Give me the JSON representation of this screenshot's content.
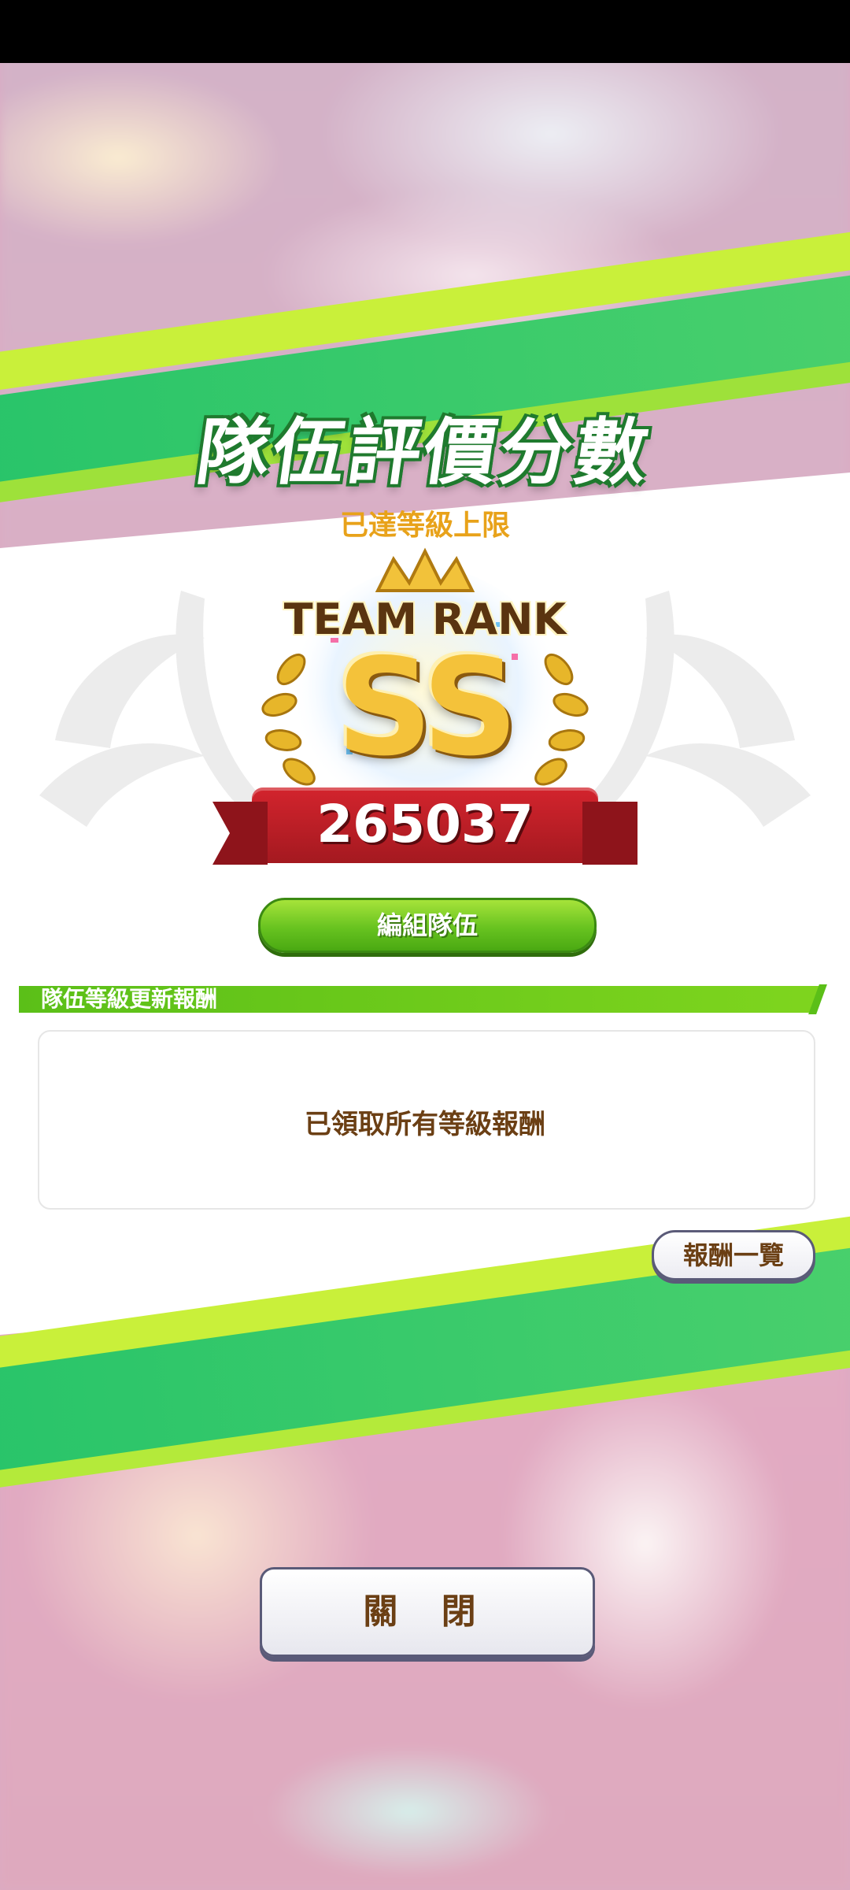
{
  "dialog": {
    "title": "隊伍評價分數",
    "subtitle": "已達等級上限",
    "emblem": {
      "header": "TEAM RANK",
      "rank": "SS",
      "score": "265037"
    },
    "edit_team_label": "編組隊伍",
    "section_label": "隊伍等級更新報酬",
    "reward_message": "已領取所有等級報酬",
    "reward_list_label": "報酬一覽",
    "close_label": "關 閉"
  },
  "colors": {
    "accent_green": "#6cc420",
    "stripe_green": "#28c46a",
    "ribbon_red": "#c81f28",
    "gold": "#f4c23a",
    "text_brown": "#6b3f14"
  }
}
